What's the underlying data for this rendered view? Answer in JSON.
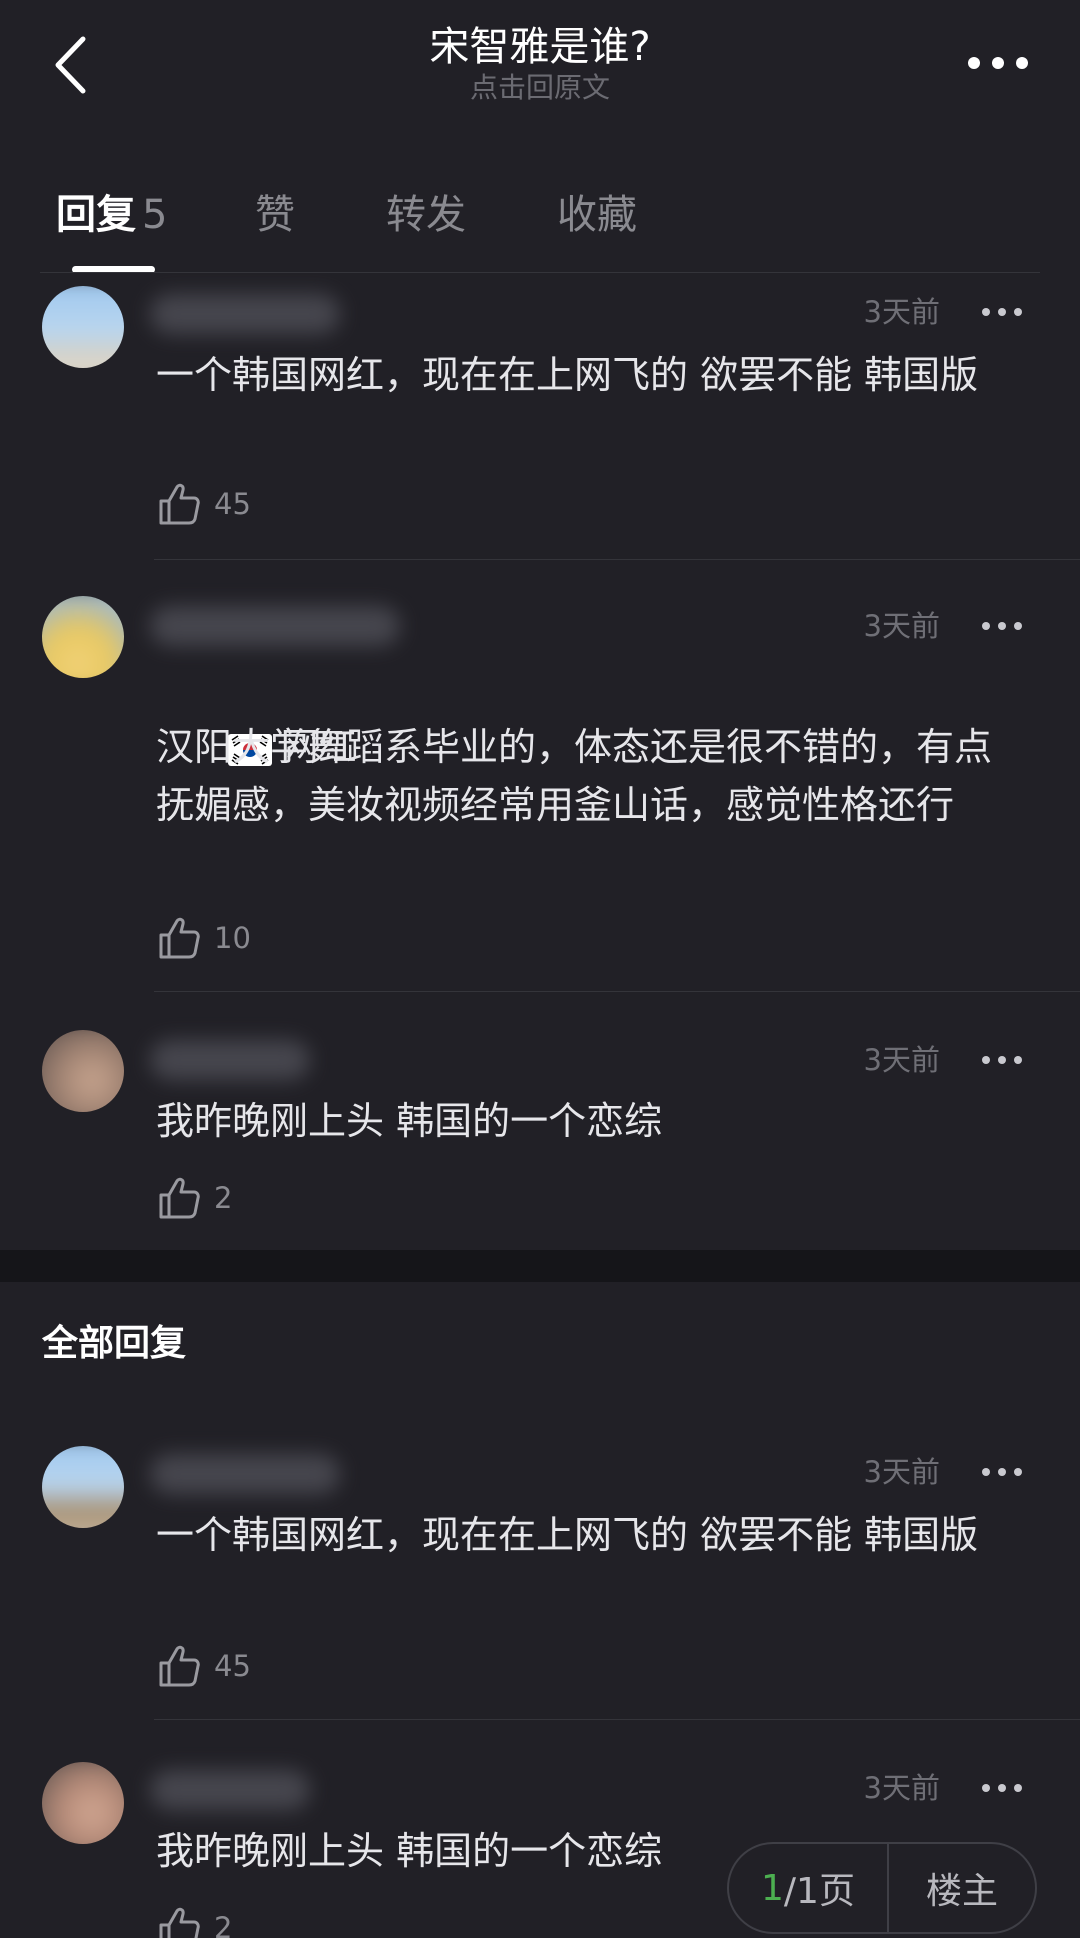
{
  "header": {
    "title": "宋智雅是谁?",
    "subtitle": "点击回原文"
  },
  "tabs": [
    {
      "label": "回复",
      "count": "5"
    },
    {
      "label": "赞"
    },
    {
      "label": "转发"
    },
    {
      "label": "收藏"
    }
  ],
  "hot_comments": [
    {
      "time": "3天前",
      "content": "一个韩国网红，现在在上网飞的 欲罢不能 韩国版",
      "likes": "45"
    },
    {
      "time": "3天前",
      "flag_text": "网红",
      "content": "汉阳大学舞蹈系毕业的，体态还是很不错的，有点抚媚感，美妆视频经常用釜山话，感觉性格还行",
      "likes": "10"
    },
    {
      "time": "3天前",
      "content": "我昨晚刚上头 韩国的一个恋综",
      "likes": "2"
    }
  ],
  "all_section": {
    "title": "全部回复"
  },
  "all_comments": [
    {
      "time": "3天前",
      "content": "一个韩国网红，现在在上网飞的 欲罢不能 韩国版",
      "likes": "45"
    },
    {
      "time": "3天前",
      "content": "我昨晚刚上头 韩国的一个恋综",
      "likes": "2"
    }
  ],
  "pager": {
    "current": "1",
    "total": "/1页",
    "owner_label": "楼主"
  },
  "colors": {
    "background": "#212026",
    "accent_green": "#4caf50"
  }
}
